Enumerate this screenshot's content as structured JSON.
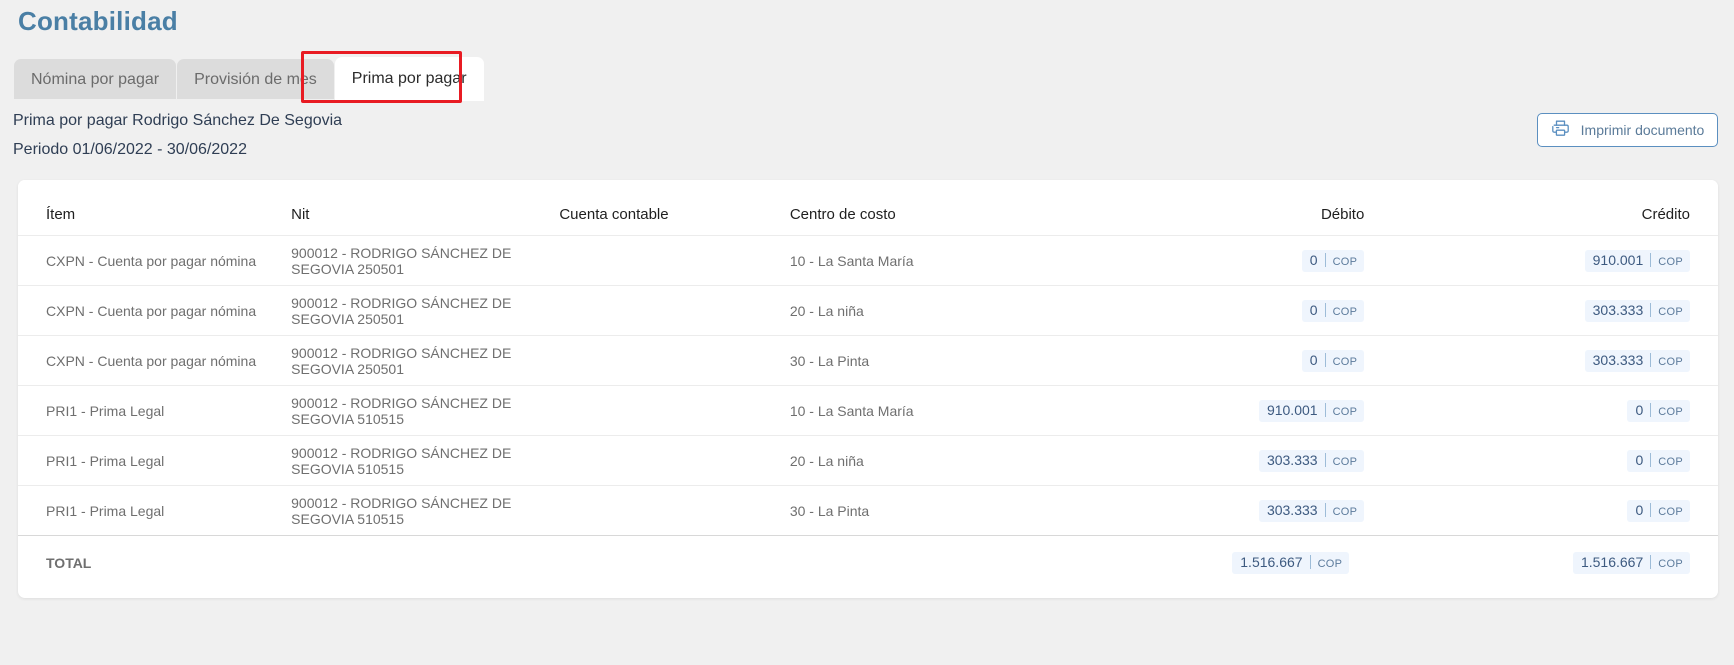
{
  "header": {
    "title": "Contabilidad"
  },
  "tabs": [
    {
      "label": "Nómina por pagar",
      "active": false
    },
    {
      "label": "Provisión de mes",
      "active": false
    },
    {
      "label": "Prima por pagar",
      "active": true
    }
  ],
  "subheader": {
    "line1": "Prima por pagar Rodrigo Sánchez De Segovia",
    "line2": "Periodo 01/06/2022 - 30/06/2022"
  },
  "actions": {
    "print_label": "Imprimir documento",
    "print_icon": "printer-icon"
  },
  "table": {
    "columns": [
      "Ítem",
      "Nit",
      "Cuenta contable",
      "Centro de costo",
      "Débito",
      "Crédito"
    ],
    "currency": "COP",
    "rows": [
      {
        "item": "CXPN - Cuenta por pagar nómina",
        "nit": "900012 - RODRIGO SÁNCHEZ DE SEGOVIA 250501",
        "cuenta": "",
        "centro": "10 - La Santa María",
        "debito": "0",
        "credito": "910.001"
      },
      {
        "item": "CXPN - Cuenta por pagar nómina",
        "nit": "900012 - RODRIGO SÁNCHEZ DE SEGOVIA 250501",
        "cuenta": "",
        "centro": "20 - La niña",
        "debito": "0",
        "credito": "303.333"
      },
      {
        "item": "CXPN - Cuenta por pagar nómina",
        "nit": "900012 - RODRIGO SÁNCHEZ DE SEGOVIA 250501",
        "cuenta": "",
        "centro": "30 - La Pinta",
        "debito": "0",
        "credito": "303.333"
      },
      {
        "item": "PRI1 - Prima Legal",
        "nit": "900012 - RODRIGO SÁNCHEZ DE SEGOVIA 510515",
        "cuenta": "",
        "centro": "10 - La Santa María",
        "debito": "910.001",
        "credito": "0"
      },
      {
        "item": "PRI1 - Prima Legal",
        "nit": "900012 - RODRIGO SÁNCHEZ DE SEGOVIA 510515",
        "cuenta": "",
        "centro": "20 - La niña",
        "debito": "303.333",
        "credito": "0"
      },
      {
        "item": "PRI1 - Prima Legal",
        "nit": "900012 - RODRIGO SÁNCHEZ DE SEGOVIA 510515",
        "cuenta": "",
        "centro": "30 - La Pinta",
        "debito": "303.333",
        "credito": "0"
      }
    ],
    "total": {
      "label": "TOTAL",
      "debito": "1.516.667",
      "credito": "1.516.667"
    }
  },
  "colors": {
    "page_title": "#4a7fa5",
    "highlight": "#e81b23",
    "money_bg": "#eff5fd",
    "money_text": "#3d5a80",
    "accent_border": "#5b8fc0",
    "background": "#f0f0f0"
  }
}
